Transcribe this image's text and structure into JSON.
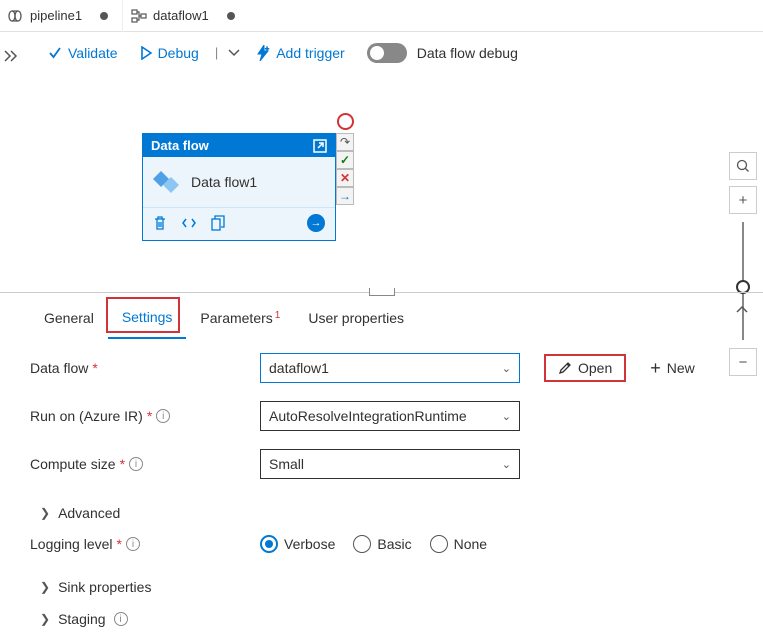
{
  "tabs": {
    "pipeline": "pipeline1",
    "dataflow": "dataflow1"
  },
  "toolbar": {
    "validate": "Validate",
    "debug": "Debug",
    "add_trigger": "Add trigger",
    "data_flow_debug": "Data flow debug"
  },
  "activity": {
    "type": "Data flow",
    "name": "Data flow1"
  },
  "panel_tabs": {
    "general": "General",
    "settings": "Settings",
    "parameters": "Parameters",
    "param_badge": "1",
    "user_properties": "User properties"
  },
  "form": {
    "dataflow_label": "Data flow",
    "dataflow_value": "dataflow1",
    "open_label": "Open",
    "new_label": "New",
    "runon_label": "Run on (Azure IR)",
    "runon_value": "AutoResolveIntegrationRuntime",
    "compute_label": "Compute size",
    "compute_value": "Small",
    "advanced": "Advanced",
    "logging_label": "Logging level",
    "log_verbose": "Verbose",
    "log_basic": "Basic",
    "log_none": "None",
    "sink_props": "Sink properties",
    "staging": "Staging"
  }
}
